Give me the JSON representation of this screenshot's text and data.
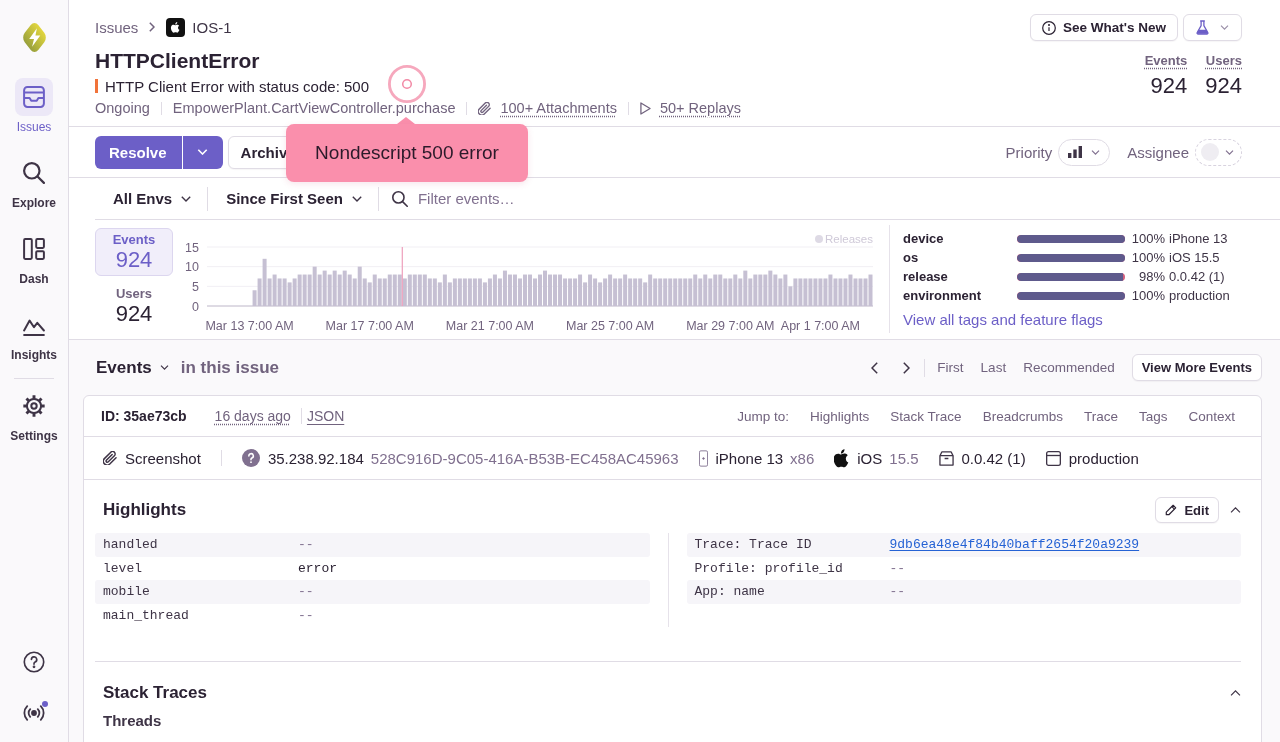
{
  "sidebar": {
    "groups": [
      {
        "items": [
          {
            "label": "Issues",
            "selected": true
          },
          {
            "label": "Explore",
            "selected": false
          },
          {
            "label": "Dash",
            "selected": false
          },
          {
            "label": "Insights",
            "selected": false
          }
        ]
      },
      {
        "items": [
          {
            "label": "Settings",
            "selected": false
          }
        ]
      }
    ],
    "broadcasts": {
      "unread": true
    }
  },
  "breadcrumb": [
    {
      "label": "Issues"
    },
    {
      "label": "IOS-1"
    }
  ],
  "header_actions": {
    "whats_new": "See What's New"
  },
  "issue": {
    "title": "HTTPClientError",
    "message": "HTTP Client Error with status code: 500",
    "meta": [
      {
        "kind": "status",
        "text": "Ongoing"
      },
      {
        "kind": "culprit",
        "text": "EmpowerPlant.CartViewController.purchase"
      },
      {
        "kind": "attachments",
        "text": "100+ Attachments"
      },
      {
        "kind": "replays",
        "text": "50+ Replays"
      }
    ],
    "stats": [
      {
        "label": "Events",
        "value": "924"
      },
      {
        "label": "Users",
        "value": "924"
      }
    ]
  },
  "actions": {
    "resolve": "Resolve",
    "archive": "Archiv",
    "priority_label": "Priority",
    "assignee_label": "Assignee"
  },
  "filters": {
    "environment": "All Envs",
    "period": "Since First Seen",
    "search": {
      "placeholder": "Filter events…"
    }
  },
  "summary": [
    {
      "label": "Events",
      "value": "924",
      "selected": true
    },
    {
      "label": "Users",
      "value": "924",
      "selected": false
    }
  ],
  "chart": {
    "legend": "Releases",
    "chart_data": {
      "type": "bar",
      "categories": [
        null,
        null,
        null,
        null,
        null,
        null,
        null,
        null,
        "Mar 13 7:00 AM",
        null,
        null,
        null,
        null,
        null,
        null,
        null,
        null,
        null,
        null,
        null,
        null,
        null,
        null,
        null,
        null,
        null,
        null,
        null,
        null,
        null,
        null,
        null,
        "Mar 17 7:00 AM",
        null,
        null,
        null,
        null,
        null,
        null,
        null,
        null,
        null,
        null,
        null,
        null,
        null,
        null,
        null,
        null,
        null,
        null,
        null,
        null,
        null,
        null,
        null,
        "Mar 21 7:00 AM",
        null,
        null,
        null,
        null,
        null,
        null,
        null,
        null,
        null,
        null,
        null,
        null,
        null,
        null,
        null,
        null,
        null,
        null,
        null,
        null,
        null,
        null,
        null,
        "Mar 25 7:00 AM",
        null,
        null,
        null,
        null,
        null,
        null,
        null,
        null,
        null,
        null,
        null,
        null,
        null,
        null,
        null,
        null,
        null,
        null,
        null,
        null,
        null,
        null,
        null,
        "Mar 29 7:00 AM",
        null,
        null,
        null,
        null,
        null,
        null,
        null,
        null,
        null,
        null,
        null,
        null,
        null,
        null,
        null,
        null,
        null,
        "Apr 1 7:00 AM",
        null,
        null,
        null,
        null,
        null,
        null,
        null,
        null,
        null,
        null
      ],
      "values": [
        0,
        0,
        0,
        0,
        0,
        0,
        0,
        0,
        0,
        4,
        7,
        12,
        7,
        8,
        7,
        7,
        6,
        7,
        8,
        8,
        8,
        10,
        8,
        9,
        8,
        9,
        8,
        9,
        8,
        7,
        10,
        7,
        6,
        8,
        7,
        7,
        8,
        8,
        8,
        7,
        8,
        8,
        8,
        8,
        7,
        7,
        6,
        8,
        6,
        7,
        7,
        7,
        7,
        7,
        7,
        6,
        7,
        8,
        7,
        9,
        8,
        8,
        7,
        8,
        8,
        7,
        8,
        9,
        8,
        8,
        8,
        7,
        7,
        7,
        8,
        6,
        8,
        7,
        6,
        7,
        8,
        7,
        7,
        8,
        7,
        7,
        7,
        6,
        8,
        7,
        7,
        7,
        7,
        7,
        7,
        7,
        7,
        8,
        7,
        8,
        7,
        8,
        8,
        7,
        7,
        8,
        7,
        9,
        7,
        8,
        8,
        8,
        9,
        8,
        7,
        8,
        5,
        7,
        7,
        7,
        7,
        7,
        7,
        7,
        8,
        7,
        7,
        7,
        8,
        7,
        7,
        7,
        8
      ],
      "ylim": [
        0,
        15
      ],
      "yticks": [
        0,
        5,
        10,
        15
      ]
    }
  },
  "tags": {
    "rows": [
      {
        "key": "device",
        "level": 1,
        "percent": "100%",
        "value": "iPhone 13"
      },
      {
        "key": "os",
        "level": 1,
        "percent": "100%",
        "value": "iOS 15.5"
      },
      {
        "key": "release",
        "level": 0.98,
        "percent": "98%",
        "value": "0.0.42 (1)"
      },
      {
        "key": "environment",
        "level": 1,
        "percent": "100%",
        "value": "production"
      }
    ],
    "link": "View all tags and feature flags"
  },
  "events": {
    "title": "Events",
    "subtitle": "in this issue",
    "nav": [
      "First",
      "Last",
      "Recommended"
    ],
    "more_button": "View More Events",
    "event": {
      "id": "ID: 35ae73cb",
      "age": "16 days ago",
      "json_link": "JSON",
      "jump_label": "Jump to:",
      "jump_links": [
        "Highlights",
        "Stack Trace",
        "Breadcrumbs",
        "Trace",
        "Tags",
        "Context"
      ],
      "context": [
        {
          "kind": "attachment",
          "title": "Screenshot"
        },
        {
          "kind": "user",
          "title": "35.238.92.184",
          "subtitle": "528C916D-9C05-416A-B53B-EC458AC45963"
        },
        {
          "kind": "device",
          "title": "iPhone 13",
          "subtitle": "x86"
        },
        {
          "kind": "os",
          "title": "iOS",
          "subtitle": "15.5"
        },
        {
          "kind": "release",
          "title": "0.0.42 (1)"
        },
        {
          "kind": "environment",
          "title": "production"
        }
      ]
    }
  },
  "highlights": {
    "title": "Highlights",
    "edit": "Edit",
    "expanded": true,
    "left": [
      {
        "kind": "empty",
        "key": "handled",
        "value": "--"
      },
      {
        "kind": "text",
        "key": "level",
        "value": "error"
      },
      {
        "kind": "empty",
        "key": "mobile",
        "value": "--"
      },
      {
        "kind": "empty",
        "key": "main_thread",
        "value": "--"
      }
    ],
    "right": [
      {
        "kind": "link",
        "key": "Trace: Trace ID",
        "value": "9db6ea48e4f84b40baff2654f20a9239"
      },
      {
        "kind": "empty",
        "key": "Profile: profile_id",
        "value": "--"
      },
      {
        "kind": "empty",
        "key": "App: name",
        "value": "--"
      }
    ]
  },
  "stack_traces": {
    "title": "Stack Traces",
    "expanded": true,
    "subtitle": "Threads"
  },
  "tooltip": {
    "text": "Nondescript 500 error"
  }
}
